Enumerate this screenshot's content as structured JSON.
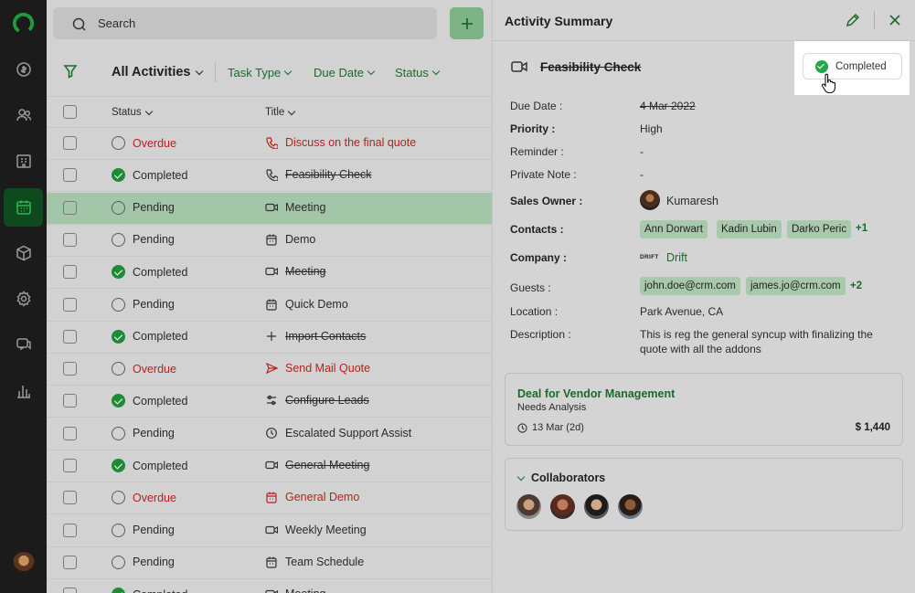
{
  "search": {
    "placeholder": "Search"
  },
  "add_button": {
    "label": "+"
  },
  "filters": {
    "view": "All Activities",
    "task_type": "Task Type",
    "due_date": "Due Date",
    "status": "Status"
  },
  "columns": {
    "status": "Status",
    "title": "Title"
  },
  "rows": [
    {
      "status": "Overdue",
      "title": "Discuss on the final quote",
      "icon": "phone-icon"
    },
    {
      "status": "Completed",
      "title": "Feasibility Check",
      "icon": "phone-icon"
    },
    {
      "status": "Pending",
      "title": "Meeting",
      "icon": "video-icon"
    },
    {
      "status": "Pending",
      "title": "Demo",
      "icon": "calendar-icon"
    },
    {
      "status": "Completed",
      "title": "Meeting",
      "icon": "video-icon"
    },
    {
      "status": "Pending",
      "title": "Quick Demo",
      "icon": "calendar-icon"
    },
    {
      "status": "Completed",
      "title": "Import Contacts",
      "icon": "plus-icon"
    },
    {
      "status": "Overdue",
      "title": "Send Mail Quote",
      "icon": "send-icon"
    },
    {
      "status": "Completed",
      "title": "Configure Leads",
      "icon": "sliders-icon"
    },
    {
      "status": "Pending",
      "title": "Escalated Support Assist",
      "icon": "clock-icon"
    },
    {
      "status": "Completed",
      "title": "General Meeting",
      "icon": "video-icon"
    },
    {
      "status": "Overdue",
      "title": "General Demo",
      "icon": "calendar-icon"
    },
    {
      "status": "Pending",
      "title": "Weekly Meeting",
      "icon": "video-icon"
    },
    {
      "status": "Pending",
      "title": "Team Schedule",
      "icon": "calendar-icon"
    },
    {
      "status": "Completed",
      "title": "Meeting",
      "icon": "video-icon"
    }
  ],
  "panel": {
    "title": "Activity Summary",
    "task_title": "Feasibility Check",
    "completed_label": "Completed",
    "fields": {
      "due_date_label": "Due Date :",
      "due_date": "4 Mar 2022",
      "priority_label": "Priority :",
      "priority": "High",
      "reminder_label": "Reminder :",
      "reminder": "-",
      "private_note_label": "Private Note :",
      "private_note": "-",
      "sales_owner_label": "Sales Owner :",
      "sales_owner": "Kumaresh",
      "contacts_label": "Contacts :",
      "contacts": [
        "Ann Dorwart",
        "Kadin Lubin",
        "Darko Peric"
      ],
      "contacts_more": "+1",
      "company_label": "Company :",
      "company_logo": "DRIFT",
      "company": "Drift",
      "guests_label": "Guests :",
      "guests": [
        "john.doe@crm.com",
        "james.jo@crm.com"
      ],
      "guests_more": "+2",
      "location_label": "Location :",
      "location": "Park Avenue, CA",
      "description_label": "Description :",
      "description_line1": "This is reg the general syncup with finalizing the",
      "description_line2": "quote with all the addons"
    },
    "deal": {
      "title": "Deal for Vendor Management",
      "stage": "Needs Analysis",
      "date": "13 Mar (2d)",
      "amount": "$ 1,440"
    },
    "collaborators": {
      "title": "Collaborators"
    }
  },
  "colors": {
    "brand_green": "#1b6a2c",
    "overdue_red": "#b3231d",
    "completed_green": "#24a84a"
  }
}
